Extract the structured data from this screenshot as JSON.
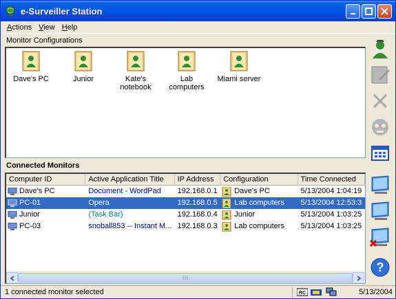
{
  "window": {
    "title": "e-Surveiller Station"
  },
  "menu": [
    {
      "label": "Actions"
    },
    {
      "label": "View"
    },
    {
      "label": "Help"
    }
  ],
  "configs": {
    "header": "Monitor Configurations",
    "items": [
      {
        "label": "Dave's PC"
      },
      {
        "label": "Junior"
      },
      {
        "label": "Kate's notebook"
      },
      {
        "label": "Lab computers"
      },
      {
        "label": "Miami server"
      }
    ]
  },
  "monitors": {
    "header": "Connected Monitors",
    "columns": [
      "Computer ID",
      "Active Application Title",
      "IP Address",
      "Configuration",
      "Time Connected"
    ],
    "rows": [
      {
        "id": "Dave's PC",
        "app": "Document - WordPad",
        "ip": "192.168.0.1",
        "config": "Dave's PC",
        "time": "5/13/2004 1:04:19",
        "selected": false
      },
      {
        "id": "PC-01",
        "app": "Opera",
        "ip": "192.168.0.5",
        "config": "Lab computers",
        "time": "5/13/2004 12:53:3",
        "selected": true
      },
      {
        "id": "Junior",
        "app": "(Task Bar)",
        "ip": "192.168.0.4",
        "config": "Junior",
        "time": "5/13/2004 1:03:25",
        "selected": false
      },
      {
        "id": "PC-03",
        "app": "snoball853 -- Instant M...",
        "ip": "192.168.0.3",
        "config": "Lab computers",
        "time": "5/13/2004 1:03:25",
        "selected": false
      }
    ]
  },
  "toolbar": [
    {
      "icon": "add-configuration-icon"
    },
    {
      "icon": "edit-icon"
    },
    {
      "icon": "delete-icon"
    },
    {
      "icon": "disconnect-icon"
    },
    {
      "icon": "view-grid-icon"
    },
    {
      "icon": "monitor-view-icon"
    },
    {
      "icon": "monitor-icon"
    },
    {
      "icon": "monitor-remove-icon"
    },
    {
      "icon": "help-icon"
    }
  ],
  "status": {
    "text": "1 connected monitor selected",
    "date": "5/13/2004"
  },
  "colors": {
    "titlebar": "#0055e5",
    "selection": "#316ac5",
    "app_text": "#000080",
    "face": "#ece9d8"
  }
}
